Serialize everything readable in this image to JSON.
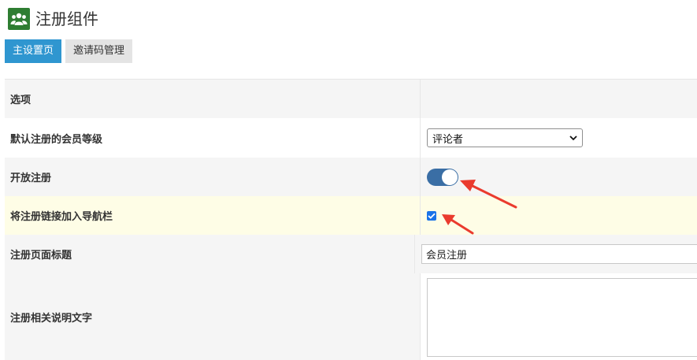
{
  "header": {
    "title": "注册组件",
    "icon": "users-icon",
    "icon_color": "#2e7d32"
  },
  "tabs": [
    {
      "label": "主设置页",
      "active": true
    },
    {
      "label": "邀请码管理",
      "active": false
    }
  ],
  "settings": {
    "section_header": "选项",
    "default_level": {
      "label": "默认注册的会员等级",
      "value": "评论者"
    },
    "open_registration": {
      "label": "开放注册",
      "enabled": true
    },
    "nav_link": {
      "label": "将注册链接加入导航栏",
      "checked": true
    },
    "page_title": {
      "label": "注册页面标题",
      "value": "会员注册"
    },
    "description": {
      "label": "注册相关说明文字",
      "value": ""
    }
  },
  "colors": {
    "accent": "#2f96d0",
    "toggle_on": "#3a6ea5",
    "checkbox": "#1a73e8",
    "annotation_arrow": "#ea3b2e"
  }
}
